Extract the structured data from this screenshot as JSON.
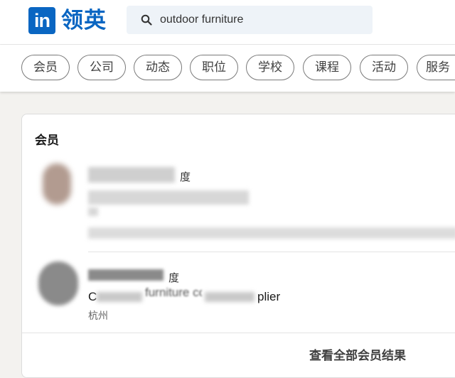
{
  "header": {
    "logo_in": "in",
    "logo_text": "领英",
    "search": {
      "value": "outdoor furniture"
    }
  },
  "filters": [
    "会员",
    "公司",
    "动态",
    "职位",
    "学校",
    "课程",
    "活动",
    "服务"
  ],
  "members_section": {
    "title": "会员",
    "results": [
      {
        "name_suffix": "度",
        "headline": "",
        "location": ""
      },
      {
        "name_suffix": "度",
        "headline_start": "C",
        "headline_mid": "furniture co",
        "headline_end": "plier",
        "location": "杭州"
      }
    ],
    "see_all": "查看全部会员结果"
  },
  "colors": {
    "brand": "#0a66c2",
    "page_bg": "#f3f2ef"
  }
}
